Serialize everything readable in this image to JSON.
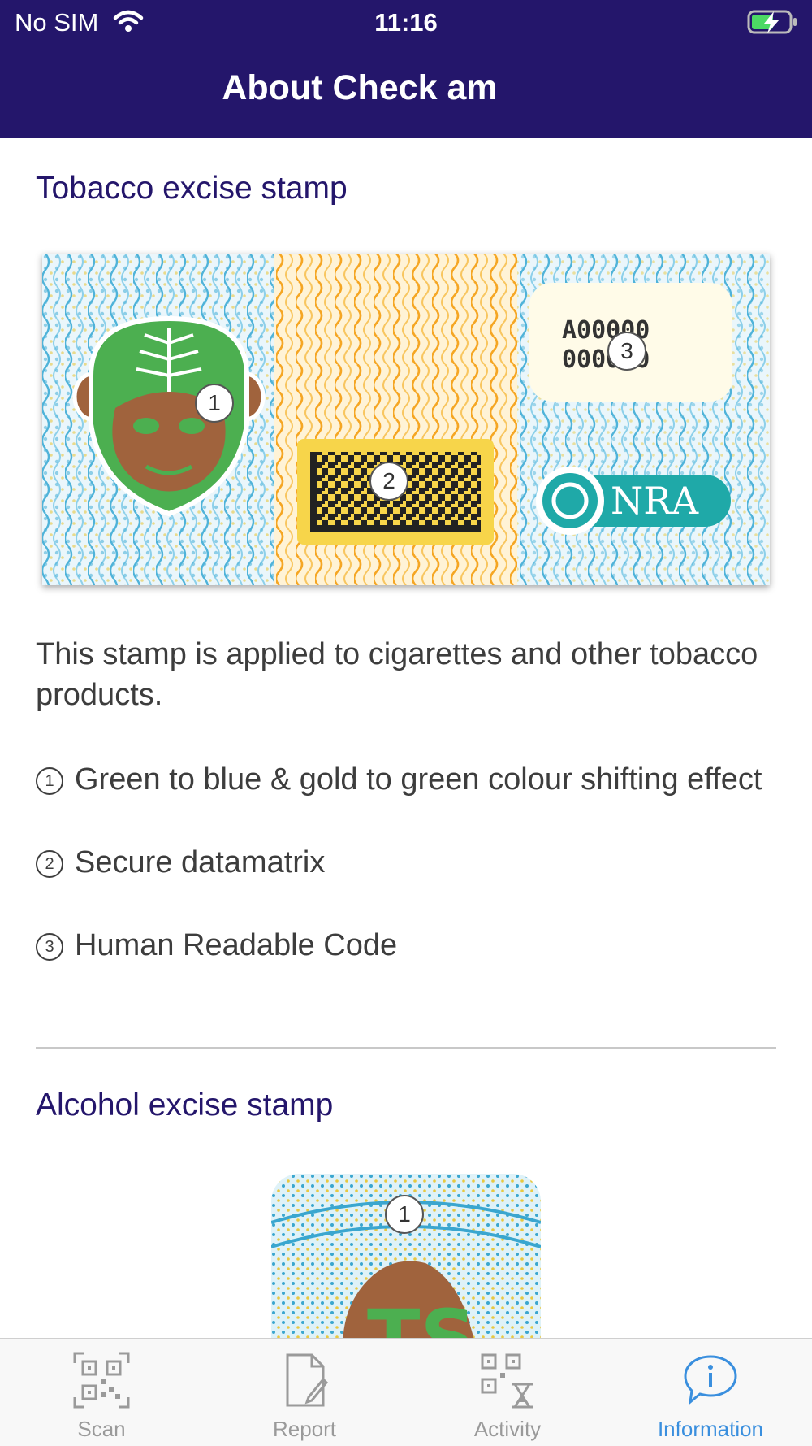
{
  "status_bar": {
    "carrier": "No SIM",
    "time": "11:16"
  },
  "nav": {
    "title": "About Check am"
  },
  "tobacco": {
    "title": "Tobacco excise stamp",
    "stamp": {
      "code_line_1": "A00000",
      "code_line_2": "000000",
      "logo_text": "NRA"
    },
    "markers": [
      "1",
      "2",
      "3"
    ],
    "description": "This stamp is applied to cigarettes and other tobacco products.",
    "features": [
      {
        "num": "1",
        "text": "Green to blue & gold to green colour shifting effect"
      },
      {
        "num": "2",
        "text": "Secure datamatrix"
      },
      {
        "num": "3",
        "text": "Human Readable Code"
      }
    ]
  },
  "alcohol": {
    "title": "Alcohol excise stamp",
    "marker": "1",
    "stamp_text": "TS"
  },
  "tabs": [
    {
      "label": "Scan",
      "icon": "qr-code-icon",
      "active": false
    },
    {
      "label": "Report",
      "icon": "document-icon",
      "active": false
    },
    {
      "label": "Activity",
      "icon": "activity-icon",
      "active": false
    },
    {
      "label": "Information",
      "icon": "info-icon",
      "active": true
    }
  ],
  "colors": {
    "nav_bg": "#24166b",
    "accent": "#3a8fde",
    "stamp_blue": "#5bc0de",
    "stamp_gold": "#f7b733",
    "stamp_green": "#4caf50"
  }
}
